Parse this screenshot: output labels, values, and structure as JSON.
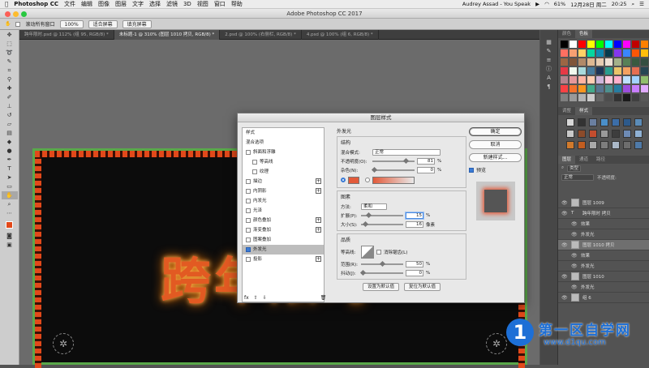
{
  "menubar": {
    "app": "Photoshop CC",
    "items": [
      "文件",
      "编辑",
      "图像",
      "图层",
      "文字",
      "选择",
      "滤镜",
      "3D",
      "视图",
      "窗口",
      "帮助"
    ],
    "now_playing": "Audrey Assad - You Speak",
    "battery": "61%",
    "date": "12月28日 周二",
    "time": "20:25"
  },
  "window": {
    "title": "Adobe Photoshop CC 2017"
  },
  "options": {
    "scroll_all": "滚动所有窗口",
    "zoom": "100%",
    "fit_screen": "适合屏幕",
    "fill_screen": "填充屏幕"
  },
  "tabs": [
    "跨年限时.psd @ 112% (组 95, RGB/8) *",
    "未标题-1 @ 310% (图层 1010 拷贝, RGB/8) *",
    "2.psd @ 100% (右侧栏, RGB/8) *",
    "4.psd @ 100% (组 6, RGB/8) *"
  ],
  "artwork": {
    "text": "跨年限时"
  },
  "dialog": {
    "title": "图层样式",
    "left_items": [
      {
        "label": "样式",
        "cb": false,
        "hasbox": false,
        "plus": false
      },
      {
        "label": "混合选项",
        "cb": false,
        "hasbox": false,
        "plus": false
      },
      {
        "label": "斜面和浮雕",
        "cb": false,
        "hasbox": true,
        "plus": false
      },
      {
        "label": "等高线",
        "cb": false,
        "hasbox": true,
        "plus": false,
        "indent": true
      },
      {
        "label": "纹理",
        "cb": false,
        "hasbox": true,
        "plus": false,
        "indent": true
      },
      {
        "label": "描边",
        "cb": false,
        "hasbox": true,
        "plus": true
      },
      {
        "label": "内阴影",
        "cb": false,
        "hasbox": true,
        "plus": true
      },
      {
        "label": "内发光",
        "cb": false,
        "hasbox": true,
        "plus": false
      },
      {
        "label": "光泽",
        "cb": false,
        "hasbox": true,
        "plus": false
      },
      {
        "label": "颜色叠加",
        "cb": false,
        "hasbox": true,
        "plus": true
      },
      {
        "label": "渐变叠加",
        "cb": false,
        "hasbox": true,
        "plus": true
      },
      {
        "label": "图案叠加",
        "cb": false,
        "hasbox": true,
        "plus": false
      },
      {
        "label": "外发光",
        "cb": true,
        "hasbox": true,
        "plus": false,
        "selected": true
      },
      {
        "label": "投影",
        "cb": false,
        "hasbox": true,
        "plus": true
      }
    ],
    "fx_label": "fx",
    "outer_glow": {
      "section": "外发光",
      "structure": "结构",
      "blend_mode_label": "混合模式:",
      "blend_mode": "正常",
      "opacity_label": "不透明度(O):",
      "opacity": "81",
      "opacity_value": 81,
      "noise_label": "杂色(N):",
      "noise": "0",
      "noise_value": 0,
      "elements": "图素",
      "method_label": "方法:",
      "method": "柔和",
      "spread_label": "扩展(P):",
      "spread": "15",
      "spread_value": 15,
      "size_label": "大小(S):",
      "size": "16",
      "size_value": 16,
      "unit_pct": "%",
      "unit_px": "像素",
      "quality": "品质",
      "contour_label": "等高线:",
      "antialias": "消除锯齿(L)",
      "range_label": "范围(R):",
      "range": "50",
      "range_value": 50,
      "jitter_label": "抖动(J):",
      "jitter": "0",
      "jitter_value": 0,
      "set_default": "设置为默认值",
      "reset_default": "复位为默认值"
    },
    "ok": "确定",
    "cancel": "取消",
    "new_style": "新建样式...",
    "preview": "预览"
  },
  "right": {
    "swatch_tabs": [
      "颜色",
      "色板"
    ],
    "style_tabs": [
      "调整",
      "样式"
    ],
    "layer_tabs": [
      "图层",
      "通道",
      "路径"
    ],
    "layers_kind": "类型",
    "layers_blend": "正常",
    "layers_opacity_label": "不透明度:",
    "layers": [
      {
        "name": "图层 1009",
        "type": "thumb",
        "sel": false
      },
      {
        "name": "跨年限时 拷贝",
        "type": "text",
        "sel": false
      },
      {
        "name": "效果",
        "type": "fx",
        "sel": false
      },
      {
        "name": "外发光",
        "type": "fx",
        "sel": false
      },
      {
        "name": "图层 1010 拷贝",
        "type": "thumb",
        "sel": true
      },
      {
        "name": "效果",
        "type": "fx",
        "sel": false
      },
      {
        "name": "外发光",
        "type": "fx",
        "sel": false
      },
      {
        "name": "图层 1010",
        "type": "thumb",
        "sel": false
      },
      {
        "name": "外发光",
        "type": "fx",
        "sel": false
      },
      {
        "name": "组 6",
        "type": "thumb",
        "sel": false
      }
    ],
    "fx": "fx"
  },
  "watermark": {
    "brand": "第一区自学网",
    "url": "www.d1qu.com"
  },
  "colors": {
    "accent": "#e2491a",
    "glow": "#ff7a00",
    "border_green": "#5aa84a"
  }
}
